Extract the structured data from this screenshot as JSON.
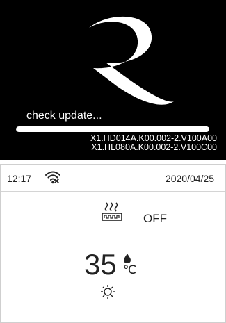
{
  "boot": {
    "status_text": "check update...",
    "progress": 1.0,
    "versions": [
      "X1.HD014A.K00.002-2.V100A00",
      "X1.HL080A.K00.002-2.V100C00"
    ],
    "logo_icon": "r-logo-icon",
    "background_color": "#000000"
  },
  "thermostat": {
    "time": "12:17",
    "date": "2020/04/25",
    "wifi_icon": "wifi-icon",
    "heater_icon": "floor-heating-icon",
    "mode_state": "OFF",
    "temperature": "35",
    "unit": "℃",
    "drop_icon": "water-drop-icon",
    "sun_icon": "sun-icon"
  }
}
